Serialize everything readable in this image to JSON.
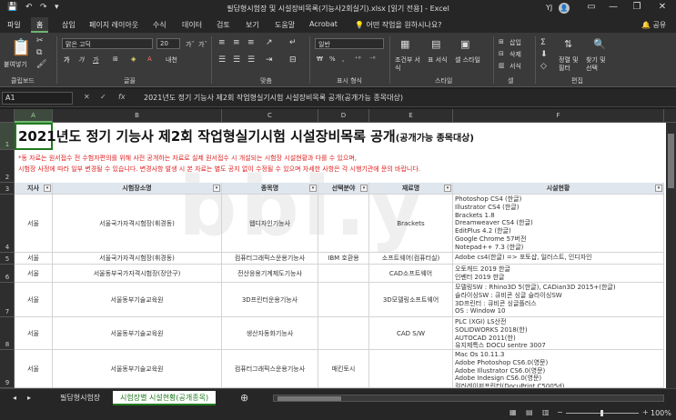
{
  "window": {
    "title": "필답형시험장 및 시설장비목록(기능사2회실기).xlsx  [읽기 전용]  -  Excel",
    "user_initials": "YJ",
    "minimize": "—",
    "restore": "❐",
    "close": "✕",
    "ribbon_toggle": "▭"
  },
  "quick_access": {
    "save": "💾",
    "undo": "↶",
    "redo": "↷",
    "more": "▾"
  },
  "ribbon_tabs": [
    "파일",
    "홈",
    "삽입",
    "페이지 레이아웃",
    "수식",
    "데이터",
    "검토",
    "보기",
    "도움말",
    "Acrobat"
  ],
  "active_tab": "홈",
  "help_search": "💡 어떤 작업을 원하시나요?",
  "share_label": "🔔 공유",
  "ribbon": {
    "clipboard": {
      "label": "클립보드",
      "paste": "붙여넣기"
    },
    "font": {
      "label": "글꼴",
      "font_name": "맑은 고딕",
      "font_size": "20",
      "bold": "가",
      "italic": "가",
      "underline": "가"
    },
    "alignment": {
      "label": "맞춤"
    },
    "number": {
      "label": "표시 형식",
      "format": "일반",
      "percent": "%",
      "comma": ",",
      "currency": "₩"
    },
    "styles": {
      "label": "스타일",
      "conditional": "조건부 서식",
      "table": "표 서식",
      "cell": "셀 스타일"
    },
    "cells": {
      "label": "셀",
      "insert": "삽입",
      "delete": "삭제",
      "format": "서식"
    },
    "editing": {
      "label": "편집",
      "sort": "정렬 및 필터",
      "find": "찾기 및 선택"
    }
  },
  "formula_bar": {
    "name_box": "A1",
    "cancel": "✕",
    "enter": "✓",
    "fx": "fx",
    "content": "2021년도 정기 기능사 제2회 작업형실기시험 시설장비목록 공개(공개가능 종목대상)"
  },
  "columns": [
    "A",
    "B",
    "C",
    "D",
    "E",
    "F"
  ],
  "selected_column": "A",
  "rows": [
    "1",
    "2",
    "3",
    "4",
    "5",
    "6",
    "7",
    "8",
    "9"
  ],
  "sheet": {
    "title_main": "2021년도 정기 기능사 제2회 작업형실기시험 시설장비목록 공개",
    "title_sub": "(공개가능 종목대상)",
    "note1": "*동 자료는 원서접수 전 수험자편의를 위해 사전 공개하는 자료로 실제 원서접수 시 개설되는 시험장 시설현황과 다를 수 있으며,",
    "note2": "시험장 사정에 따라 일부 변경될 수 있습니다. 변경사항 발생 시 본 자료는 별도 공지 없이 수정될 수 있으며 자세한 사항은 각 시행기관에 문의 바랍니다.",
    "watermark": "bbl.y",
    "headers": [
      "지사",
      "시험장소명",
      "종목명",
      "선택분야",
      "재료명",
      "시설현황"
    ],
    "data_rows": [
      {
        "branch": "서울",
        "place": "서울국가자격시험장(휘경동)",
        "job": "웹디자인기능사",
        "field": "",
        "material": "Brackets",
        "facilities": "Photoshop CS4 (한글)\nIllustrator CS4 (한글)\nBrackets 1.8\nDreamweaver CS4 (한글)\nEditPlus 4.2 (한글)\nGoogle Chrome 57버전\nNotepad++ 7.3 (한글)"
      },
      {
        "branch": "서울",
        "place": "서울국가자격시험장(휘경동)",
        "job": "컴퓨터그래픽스운용기능사",
        "field": "IBM 호환용",
        "material": "소프트웨어(컴퓨터실)",
        "facilities": "Adobe cs4(한글) => 포토샵, 일러스트, 인디자인"
      },
      {
        "branch": "서울",
        "place": "서울동부국가자격시험장(장안구)",
        "job": "전산응용기계제도기능사",
        "field": "",
        "material": "CAD소프트웨어",
        "facilities": "오토캐드 2019 한글\n인벤터 2019 한글"
      },
      {
        "branch": "서울",
        "place": "서울동부기술교육원",
        "job": "3D프린터운용기능사",
        "field": "",
        "material": "3D모델링소프트웨어",
        "facilities": "모델링SW : Rhino3D 5(한글), CADian3D 2015+(한글)\n슬라이싱SW : 큐비콘 싱글 슬라이싱SW\n3D프린터 : 큐비콘 싱글플러스\nOS : Window 10"
      },
      {
        "branch": "서울",
        "place": "서울동부기술교육원",
        "job": "생산자동화기능사",
        "field": "",
        "material": "CAD S/W",
        "facilities": "PLC (XGI) LS산전\nSOLIDWORKS 2018(한)\nAUTOCAD 2011(한)\n유지제특스 DOCU sentre 3007"
      },
      {
        "branch": "서울",
        "place": "서울동부기술교육원",
        "job": "컴퓨터그래픽스운용기능사",
        "field": "매킨토시",
        "material": "",
        "facilities": "Mac Os 10.11.3\nAdobe Photoshop CS6.0(영문)\nAdobe Illustrator CS6.0(영문)\nAdobe Indesign CS6.0(영문)\n컬러레이저프린터(DocuPrint C5005d)"
      }
    ]
  },
  "sheet_tabs": [
    "필답형시험장",
    "시험장별 시설현황(공개종목)"
  ],
  "active_sheet": "시험장별 시설현황(공개종목)",
  "add_sheet": "⊕",
  "zoom": "100%"
}
